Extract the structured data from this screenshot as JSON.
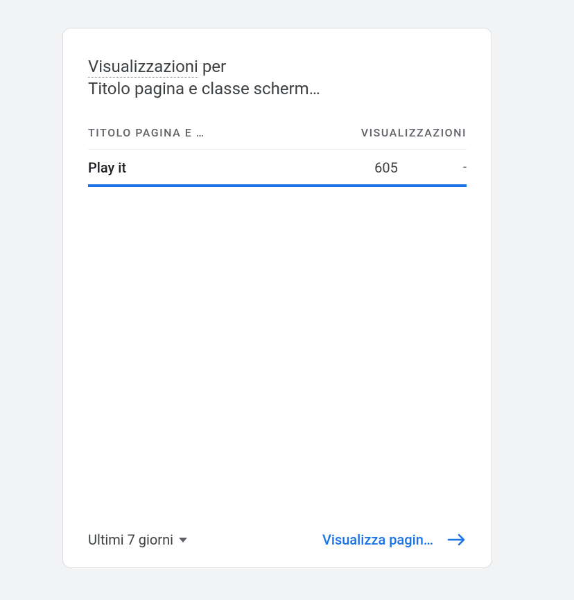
{
  "card": {
    "title_prefix": "Visualizzazioni",
    "title_suffix": " per",
    "dimension_label": "Titolo pagina e classe scherm…",
    "columns": {
      "dimension": "TITOLO PAGINA E …",
      "metric": "VISUALIZZAZIONI"
    },
    "rows": [
      {
        "dimension": "Play it",
        "metric": "605",
        "delta": "-"
      }
    ],
    "footer": {
      "date_range": "Ultimi 7 giorni",
      "view_link": "Visualizza pagin…"
    }
  },
  "colors": {
    "accent": "#1a73e8"
  }
}
